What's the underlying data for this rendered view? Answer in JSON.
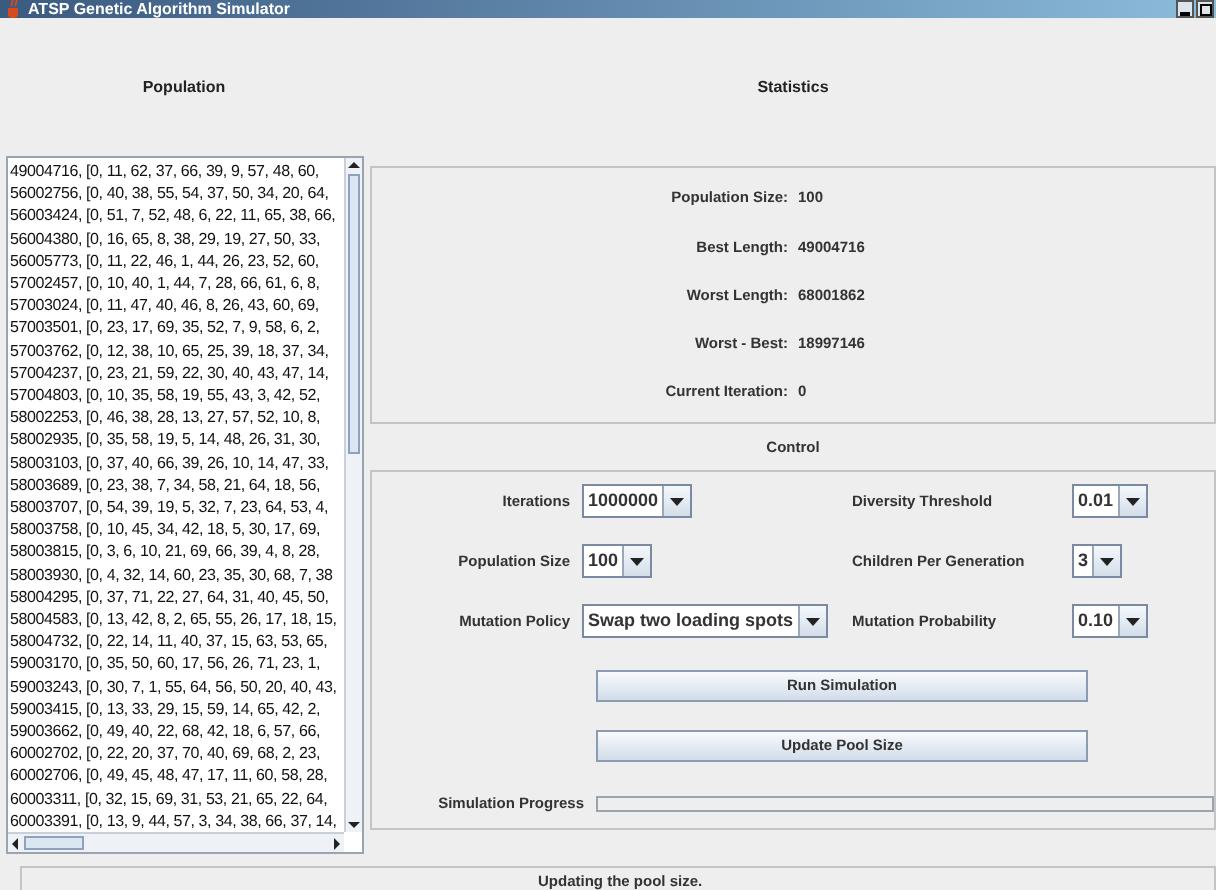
{
  "window": {
    "title": "ATSP Genetic Algorithm Simulator"
  },
  "population": {
    "heading": "Population",
    "rows": [
      "49004716, [0, 11, 62, 37, 66, 39, 9, 57, 48, 60,",
      "56002756, [0, 40, 38, 55, 54, 37, 50, 34, 20, 64,",
      "56003424, [0, 51, 7, 52, 48, 6, 22, 11, 65, 38, 66,",
      "56004380, [0, 16, 65, 8, 38, 29, 19, 27, 50, 33,",
      "56005773, [0, 11, 22, 46, 1, 44, 26, 23, 52, 60,",
      "57002457, [0, 10, 40, 1, 44, 7, 28, 66, 61, 6, 8,",
      "57003024, [0, 11, 47, 40, 46, 8, 26, 43, 60, 69,",
      "57003501, [0, 23, 17, 69, 35, 52, 7, 9, 58, 6, 2,",
      "57003762, [0, 12, 38, 10, 65, 25, 39, 18, 37, 34,",
      "57004237, [0, 23, 21, 59, 22, 30, 40, 43, 47, 14,",
      "57004803, [0, 10, 35, 58, 19, 55, 43, 3, 42, 52,",
      "58002253, [0, 46, 38, 28, 13, 27, 57, 52, 10, 8,",
      "58002935, [0, 35, 58, 19, 5, 14, 48, 26, 31, 30,",
      "58003103, [0, 37, 40, 66, 39, 26, 10, 14, 47, 33,",
      "58003689, [0, 23, 38, 7, 34, 58, 21, 64, 18, 56,",
      "58003707, [0, 54, 39, 19, 5, 32, 7, 23, 64, 53, 4,",
      "58003758, [0, 10, 45, 34, 42, 18, 5, 30, 17, 69,",
      "58003815, [0, 3, 6, 10, 21, 69, 66, 39, 4, 8, 28,",
      "58003930, [0, 4, 32, 14, 60, 23, 35, 30, 68, 7, 38",
      "58004295, [0, 37, 71, 22, 27, 64, 31, 40, 45, 50,",
      "58004583, [0, 13, 42, 8, 2, 65, 55, 26, 17, 18, 15,",
      "58004732, [0, 22, 14, 11, 40, 37, 15, 63, 53, 65,",
      "59003170, [0, 35, 50, 60, 17, 56, 26, 71, 23, 1,",
      "59003243, [0, 30, 7, 1, 55, 64, 56, 50, 20, 40, 43,",
      "59003415, [0, 13, 33, 29, 15, 59, 14, 65, 42, 2,",
      "59003662, [0, 49, 40, 22, 68, 42, 18, 6, 57, 66,",
      "60002702, [0, 22, 20, 37, 70, 40, 69, 68, 2, 23,",
      "60002706, [0, 49, 45, 48, 47, 17, 11, 60, 58, 28,",
      "60003311, [0, 32, 15, 69, 31, 53, 21, 65, 22, 64,",
      "60003391, [0, 13, 9, 44, 57, 3, 34, 38, 66, 37, 14,"
    ]
  },
  "statistics": {
    "heading": "Statistics",
    "items": [
      {
        "label": "Population Size:",
        "value": "100"
      },
      {
        "label": "Best Length:",
        "value": "49004716"
      },
      {
        "label": "Worst Length:",
        "value": "68001862"
      },
      {
        "label": "Worst - Best:",
        "value": "18997146"
      },
      {
        "label": "Current Iteration:",
        "value": "0"
      }
    ]
  },
  "control": {
    "heading": "Control",
    "settings": [
      {
        "label": "Iterations",
        "value": "1000000"
      },
      {
        "label": "Diversity Threshold",
        "value": "0.01"
      },
      {
        "label": "Population Size",
        "value": "100"
      },
      {
        "label": "Children Per Generation",
        "value": "3"
      },
      {
        "label": "Mutation Policy",
        "value": "Swap two loading spots"
      },
      {
        "label": "Mutation Probability",
        "value": "0.10"
      }
    ],
    "buttons": [
      "Run Simulation",
      "Update Pool Size"
    ],
    "progress": {
      "label": "Simulation Progress",
      "level": 0
    }
  },
  "status_bar": "Updating the pool size."
}
